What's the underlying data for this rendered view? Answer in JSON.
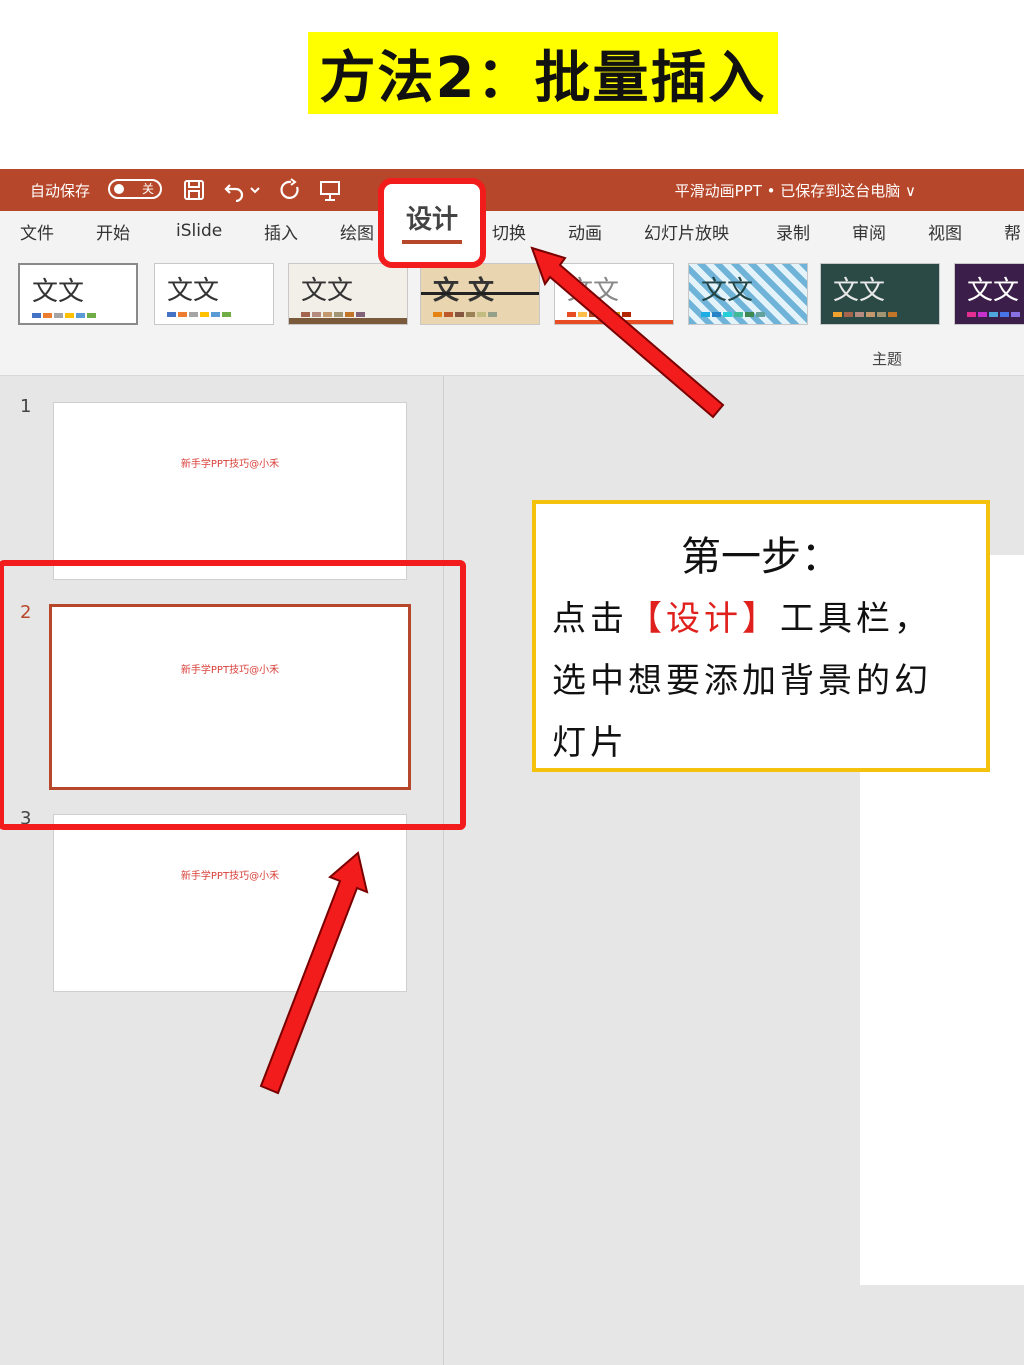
{
  "headline": "方法2：批量插入",
  "titlebar": {
    "autosave_label": "自动保存",
    "autosave_state": "关",
    "doc_title": "平滑动画PPT • 已保存到这台电脑 ∨",
    "background": "#b7472a"
  },
  "tabs": [
    "文件",
    "开始",
    "iSlide",
    "插入",
    "绘图",
    "设计",
    "切换",
    "动画",
    "幻灯片放映",
    "录制",
    "审阅",
    "视图",
    "帮"
  ],
  "active_tab": "设计",
  "themes": {
    "sample_text": "文文",
    "alt_text": "文 文",
    "group_label": "主题"
  },
  "slides": [
    {
      "number": "1",
      "text": "新手学PPT技巧@小禾"
    },
    {
      "number": "2",
      "text": "新手学PPT技巧@小禾"
    },
    {
      "number": "3",
      "text": "新手学PPT技巧@小禾"
    }
  ],
  "callout": {
    "title": "第一步：",
    "line1_pre": "点击",
    "line1_highlight": "【设计】",
    "line1_post": "工具栏，",
    "line2": "选中想要添加背景的幻",
    "line3": "灯片"
  },
  "colors": {
    "accent": "#b7472a",
    "annotation_red": "#f21c1c",
    "callout_border": "#f4c20d",
    "headline_bg": "#ffff00"
  }
}
